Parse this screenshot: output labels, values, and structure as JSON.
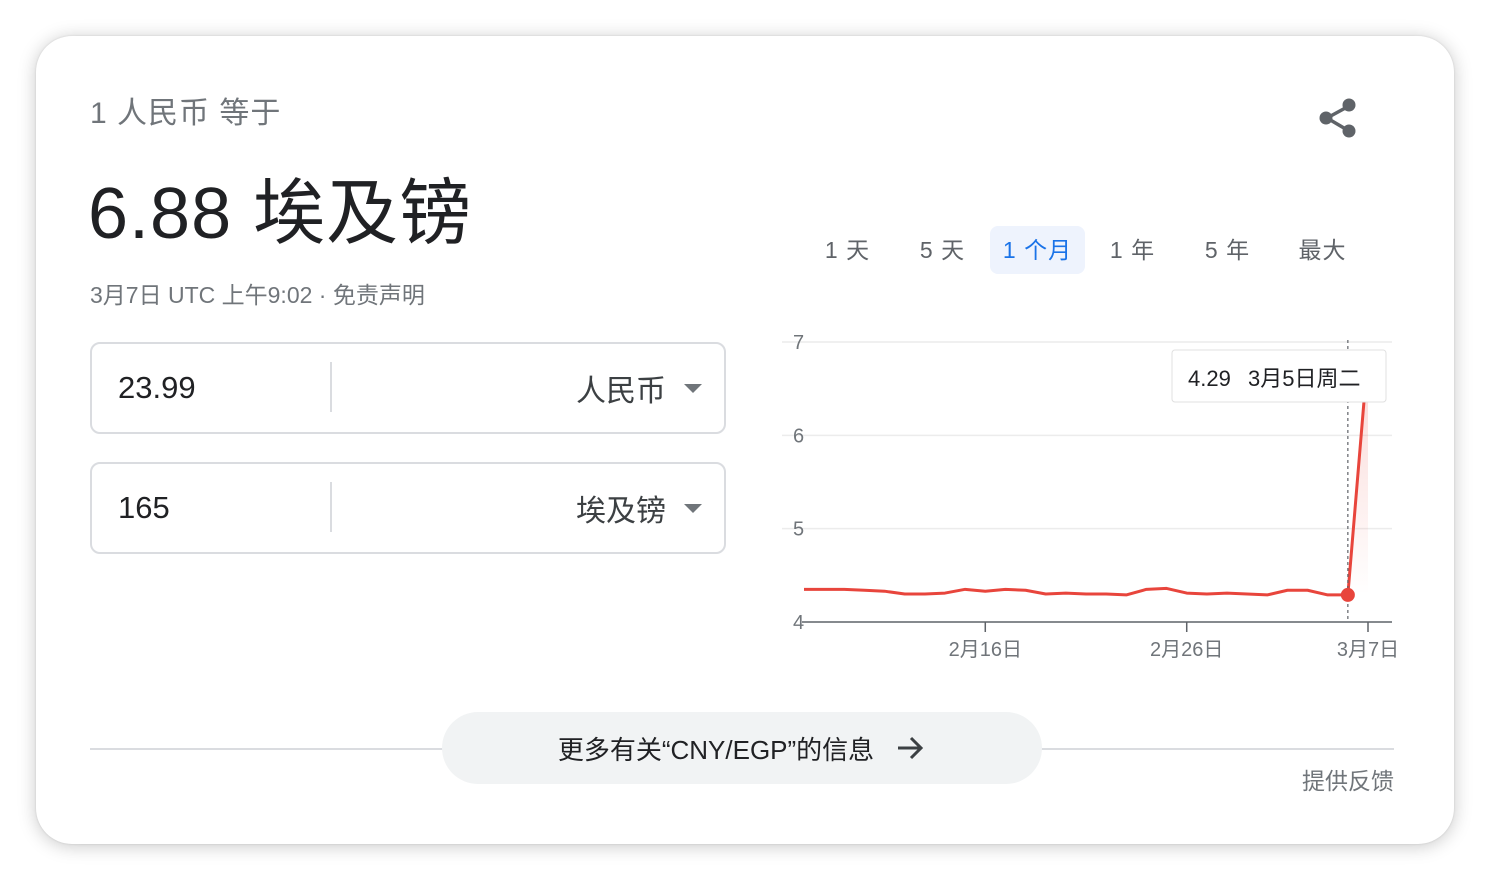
{
  "header": {
    "subtitle": "1 人民币 等于",
    "result": "6.88 埃及镑",
    "meta": "3月7日 UTC 上午9:02 · 免责声明"
  },
  "converter": {
    "from": {
      "amount": "23.99",
      "currency": "人民币"
    },
    "to": {
      "amount": "165",
      "currency": "埃及镑"
    }
  },
  "ranges": [
    {
      "label": "1 天"
    },
    {
      "label": "5 天"
    },
    {
      "label": "1 个月",
      "active": true
    },
    {
      "label": "1 年"
    },
    {
      "label": "5 年"
    },
    {
      "label": "最大"
    }
  ],
  "tooltip": {
    "value": "4.29",
    "date": "3月5日周二"
  },
  "more": {
    "label": "更多有关“CNY/EGP”的信息"
  },
  "feedback": "提供反馈",
  "colors": {
    "line": "#e8453c",
    "active": "#1a73e8"
  },
  "icons": {
    "share": "share-icon",
    "more_arrow": "arrow-right-icon",
    "dropdown": "caret-down-icon"
  },
  "chart_data": {
    "type": "line",
    "series": [
      {
        "values": [
          4.35,
          4.35,
          4.35,
          4.34,
          4.33,
          4.3,
          4.3,
          4.31,
          4.35,
          4.33,
          4.35,
          4.34,
          4.3,
          4.31,
          4.3,
          4.3,
          4.29,
          4.35,
          4.36,
          4.31,
          4.3,
          4.31,
          4.3,
          4.29,
          4.34,
          4.34,
          4.29,
          4.29,
          6.88
        ]
      }
    ],
    "ylim": [
      4,
      7
    ],
    "yticks": [
      "7",
      "6",
      "5",
      "4"
    ],
    "xticks": [
      "2月16日",
      "2月26日",
      "3月7日"
    ],
    "highlight_index": 27,
    "grid": true
  }
}
